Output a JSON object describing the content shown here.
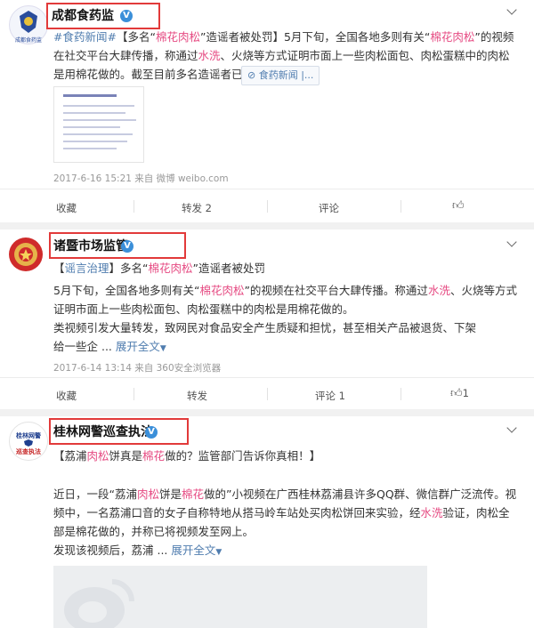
{
  "posts": [
    {
      "account": "成都食药监",
      "avatar_label": "成都食药监",
      "hashtag": "#食药新闻#",
      "bracket_open": "【",
      "title_pre": "多名“",
      "title_hl": "棉花肉松",
      "title_post": "”造谣者被处罚",
      "bracket_close": "】",
      "body_1": "5月下旬，全国各地多则有关“",
      "body_hl1": "棉花肉松",
      "body_2": "”的视频在社交平台大肆传播，称通过",
      "body_hl2": "水洗",
      "body_3": "、火烧等方式证明市面上一些肉松面包、肉松蛋糕中的肉松是用棉花做的。截至目前多名造谣者已被处罚。",
      "tag_label": "食药新闻 |...",
      "meta": "2017-6-16 15:21 来自 微博 weibo.com",
      "actions": {
        "collect": "收藏",
        "repost": "转发 2",
        "comment": "评论",
        "like": ""
      }
    },
    {
      "account": "诸暨市场监管",
      "bracket_open": "【",
      "category": "谣言治理",
      "bracket_close": "】",
      "title_pre": "多名“",
      "title_hl": "棉花肉松",
      "title_post": "”造谣者被处罚",
      "body_1": "5月下旬，全国各地多则有关“",
      "body_hl1": "棉花肉松",
      "body_2": "”的视频在社交平台大肆传播。称通过",
      "body_hl2": "水洗",
      "body_3": "、火烧等方式证明市面上一些肉松面包、肉松蛋糕中的肉松是用棉花做的。",
      "body_4": "类视频引发大量转发，致网民对食品安全产生质疑和担忧，甚至相关产品被退货、下架",
      "body_5": "给一些企 ...",
      "expand": "展开全文",
      "meta": "2017-6-14 13:14 来自 360安全浏览器",
      "actions": {
        "collect": "收藏",
        "repost": "转发",
        "comment": "评论 1",
        "like": "1"
      }
    },
    {
      "account": "桂林网警巡查执法",
      "avatar_label_top": "桂林网警",
      "avatar_label_bottom": "巡查执法",
      "title_open": "【荔浦",
      "title_hl1": "肉松",
      "title_mid": "饼真是",
      "title_hl2": "棉花",
      "title_post": "做的？监管部门告诉你真相！】",
      "body_1": "近日，一段“荔浦",
      "body_hl1": "肉松",
      "body_2": "饼是",
      "body_hl2": "棉花",
      "body_3": "做的”小视频在广西桂林荔浦县许多QQ群、微信群广泛流传。视频中，一名荔浦口音的女子自称特地从搭马岭车站处买肉松饼回来实验，经",
      "body_hl3": "水洗",
      "body_4": "验证，肉松全部是棉花做的，并称已将视频发至网上。",
      "body_5": "发现该视频后，荔浦 ...",
      "expand": "展开全文"
    }
  ],
  "colors": {
    "highlight": "#e64a82",
    "link": "#507daf",
    "box": "#e23a3a"
  }
}
